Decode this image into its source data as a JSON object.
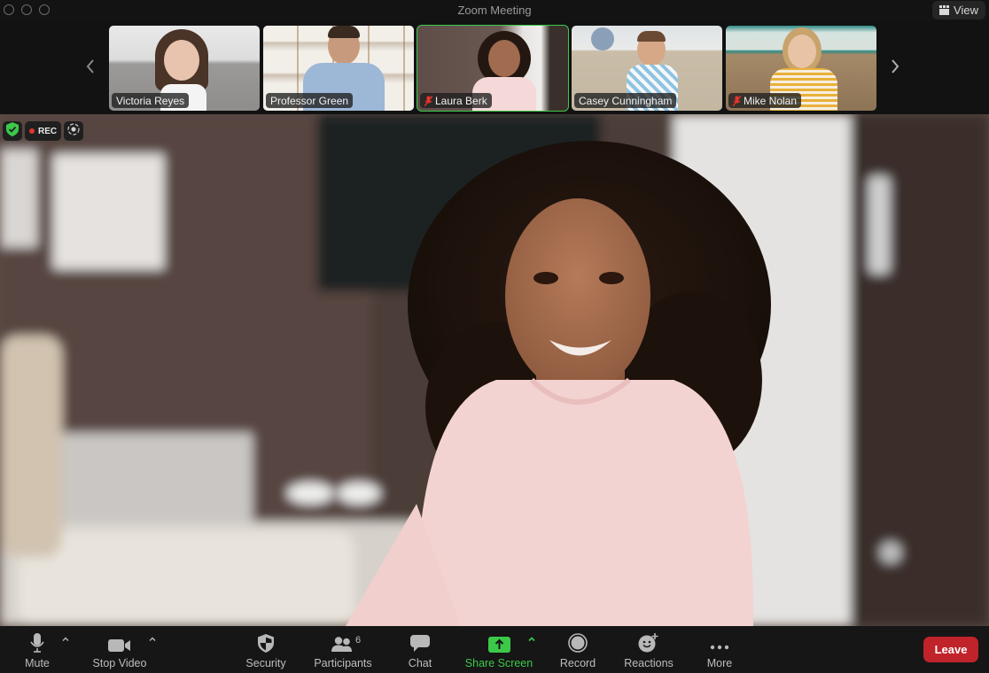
{
  "window": {
    "title": "Zoom Meeting",
    "view_button": "View"
  },
  "status_badges": {
    "encrypted": "shield-check-icon",
    "recording_label": "REC",
    "live_icon": "live-transcript-icon"
  },
  "participants_strip": [
    {
      "name": "Victoria Reyes",
      "muted": false,
      "active_speaker": false
    },
    {
      "name": "Professor Green",
      "muted": false,
      "active_speaker": false
    },
    {
      "name": "Laura Berk",
      "muted": true,
      "active_speaker": true
    },
    {
      "name": "Casey Cunningham",
      "muted": false,
      "active_speaker": false
    },
    {
      "name": "Mike Nolan",
      "muted": true,
      "active_speaker": false
    }
  ],
  "main_video": {
    "speaker": "Laura Berk"
  },
  "toolbar": {
    "mute": "Mute",
    "stop_video": "Stop Video",
    "security": "Security",
    "participants": "Participants",
    "participants_count": "6",
    "chat": "Chat",
    "share_screen": "Share Screen",
    "record": "Record",
    "reactions": "Reactions",
    "more": "More",
    "leave": "Leave"
  },
  "colors": {
    "accent_green": "#3cc94a",
    "leave_red": "#c0232a",
    "muted_red": "#e5342f"
  }
}
